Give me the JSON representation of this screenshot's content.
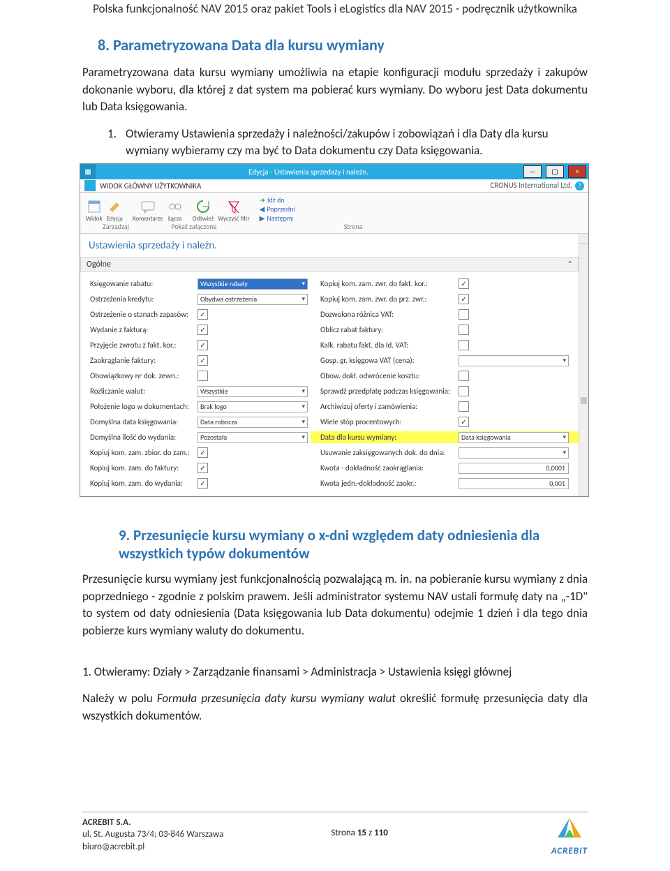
{
  "doc_header": "Polska funkcjonalność NAV 2015 oraz pakiet Tools i eLogistics dla NAV 2015 - podręcznik użytkownika",
  "section8": {
    "num": "8.",
    "title": "Parametryzowana Data dla kursu wymiany",
    "para": "Parametryzowana data kursu wymiany umożliwia na etapie konfiguracji modułu sprzedaży i zakupów dokonanie wyboru, dla której z dat system ma pobierać kurs wymiany. Do wyboru jest Data dokumentu lub Data księgowania.",
    "step1_num": "1.",
    "step1": "Otwieramy Ustawienia sprzedaży i należności/zakupów i zobowiązań i dla Daty dla kursu wymiany wybieramy czy ma być to Data dokumentu czy Data księgowania."
  },
  "nav": {
    "window_title": "Edycja - Ustawienia sprzedaży i należn.",
    "ribbon_tab": "WIDOK GŁÓWNY UŻYTKOWNIKA",
    "company": "CRONUS International Ltd.",
    "icons": {
      "widok": "Widok",
      "edycja": "Edycja",
      "komentarze": "Komentarze",
      "lacza": "Łącza",
      "odswiez": "Odśwież",
      "wyczysc": "Wyczyść filtr",
      "idz": "Idź do",
      "poprzedni": "Poprzedni",
      "nastepny": "Następny"
    },
    "ribbon_groups": {
      "g1": "Zarządzaj",
      "g2": "Pokaż załączone",
      "g3": "Strona"
    },
    "form_title": "Ustawienia sprzedaży i należn.",
    "section_label": "Ogólne",
    "left": {
      "r1_lbl": "Księgowanie rabatu:",
      "r1_val": "Wszystkie rabaty",
      "r2_lbl": "Ostrzeżenia kredytu:",
      "r2_val": "Obydwa ostrzeżenia",
      "r3_lbl": "Ostrzeżenie o stanach zapasów:",
      "r3_chk": true,
      "r4_lbl": "Wydanie z fakturą:",
      "r4_chk": true,
      "r5_lbl": "Przyjęcie zwrotu z fakt. kor.:",
      "r5_chk": true,
      "r6_lbl": "Zaokrąglanie faktury:",
      "r6_chk": true,
      "r7_lbl": "Obowiązkowy nr dok. zewn.:",
      "r7_chk": false,
      "r8_lbl": "Rozliczanie walut:",
      "r8_val": "Wszystkie",
      "r9_lbl": "Położenie logo w dokumentach:",
      "r9_val": "Brak logo",
      "r10_lbl": "Domyślna data księgowania:",
      "r10_val": "Data robocza",
      "r11_lbl": "Domyślna ilość do wydania:",
      "r11_val": "Pozostała",
      "r12_lbl": "Kopiuj kom. zam. zbior. do zam.:",
      "r12_chk": true,
      "r13_lbl": "Kopiuj kom. zam. do faktury:",
      "r13_chk": true,
      "r14_lbl": "Kopiuj kom. zam. do wydania:",
      "r14_chk": true
    },
    "right": {
      "r1_lbl": "Kopiuj kom. zam. zwr. do fakt. kor.:",
      "r1_chk": true,
      "r2_lbl": "Kopiuj kom. zam. zwr. do prz. zwr.:",
      "r2_chk": true,
      "r3_lbl": "Dozwolona różnica VAT:",
      "r3_chk": false,
      "r4_lbl": "Oblicz rabat faktury:",
      "r4_chk": false,
      "r5_lbl": "Kalk. rabatu fakt. dla Id. VAT:",
      "r5_chk": false,
      "r6_lbl": "Gosp. gr. księgowa VAT (cena):",
      "r6_val": "",
      "r7_lbl": "Obow. dokł. odwrócenie kosztu:",
      "r7_chk": false,
      "r8_lbl": "Sprawdź przedpłatę podczas księgowania:",
      "r8_chk": false,
      "r9_lbl": "Archiwizuj oferty i zamówienia:",
      "r9_chk": false,
      "r10_lbl": "Wiele stóp procentowych:",
      "r10_chk": true,
      "r11_lbl": "Data dla kursu wymiany:",
      "r11_val": "Data księgowania",
      "r12_lbl": "Usuwanie zaksięgowanych dok. do dnia:",
      "r12_val": "",
      "r13_lbl": "Kwota - dokładność zaokrąglania:",
      "r13_val": "0,0001",
      "r14_lbl": "Kwota jedn.-dokładność zaokr.:",
      "r14_val": "0,001"
    }
  },
  "section9": {
    "num": "9.",
    "title": "Przesunięcie kursu wymiany o x-dni względem daty odniesienia dla wszystkich typów dokumentów",
    "para": "Przesunięcie kursu wymiany jest funkcjonalnością pozwalającą m. in. na pobieranie kursu wymiany z dnia poprzedniego - zgodnie z polskim prawem. Jeśli administrator systemu NAV ustali formułę daty na „-1D\" to system od daty odniesienia (Data księgowania lub Data dokumentu) odejmie 1 dzień i dla tego dnia pobierze kurs wymiany waluty do dokumentu.",
    "step1": "1. Otwieramy: Działy > Zarządzanie finansami > Administracja > Ustawienia księgi głównej",
    "note_pre": "Należy w polu ",
    "note_em": "Formuła przesunięcia daty kursu wymiany walut",
    "note_post": " określić formułę przesunięcia daty dla wszystkich dokumentów."
  },
  "footer": {
    "company_name": "ACREBIT S.A.",
    "address": "ul. St. Augusta 73/4; 03-846 Warszawa",
    "email": "biuro@acrebit.pl",
    "page_label": "Strona ",
    "page_num": "15",
    "page_sep": " z ",
    "page_total": "110",
    "brand": "ACREBIT"
  }
}
